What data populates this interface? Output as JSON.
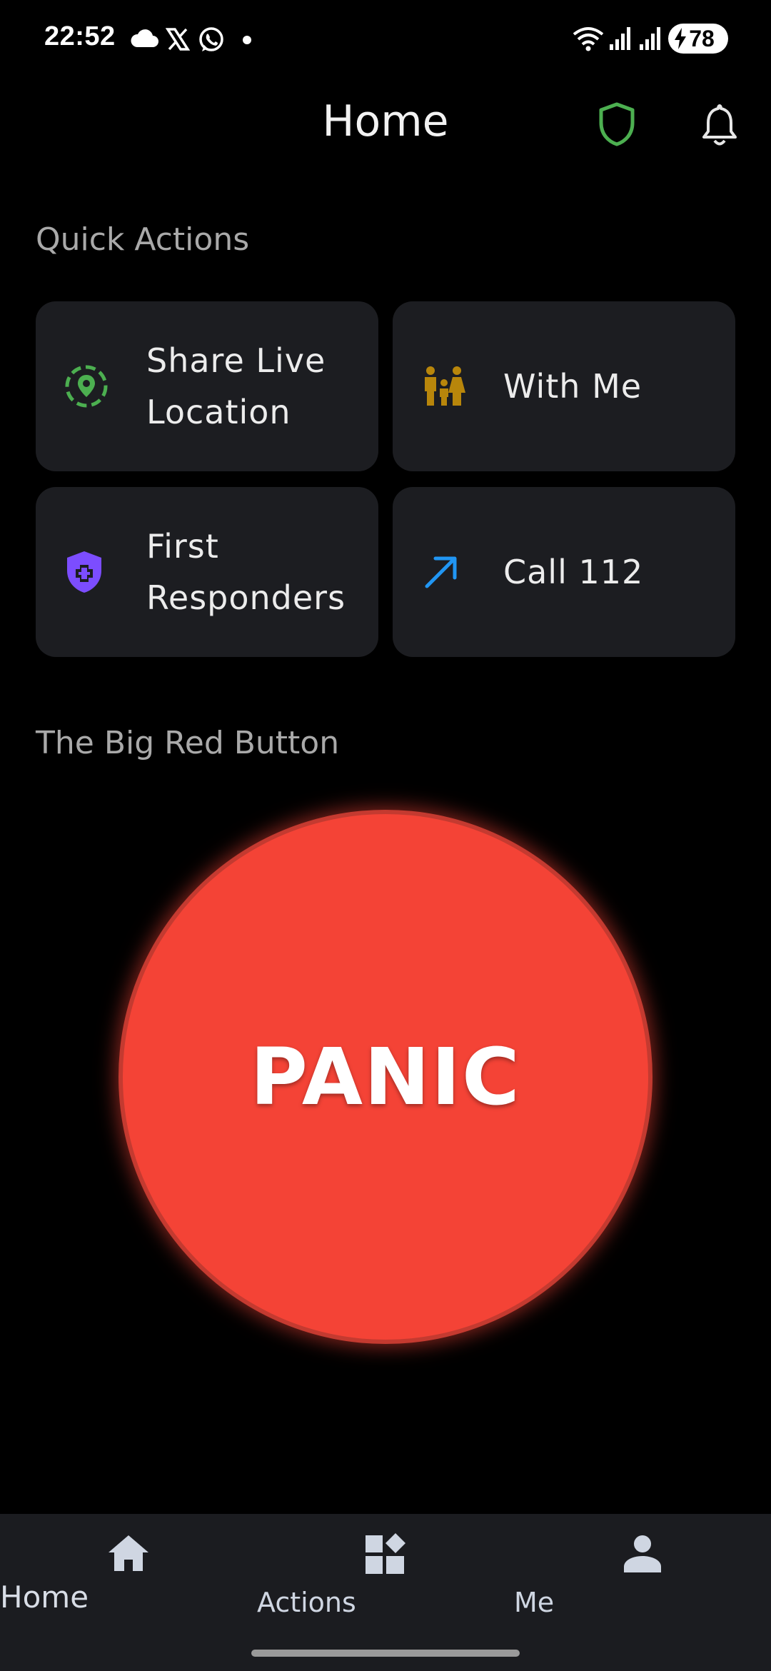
{
  "status_bar": {
    "time": "22:52",
    "battery": "78",
    "icons": [
      "cloud-icon",
      "x-logo-icon",
      "whatsapp-icon",
      "wifi-icon",
      "signal-icon",
      "signal-icon",
      "battery-icon"
    ]
  },
  "header": {
    "title": "Home",
    "icons": [
      "shield-icon",
      "bell-icon"
    ],
    "shield_color": "#4caf50"
  },
  "quick_actions": {
    "title": "Quick Actions",
    "items": [
      {
        "label": "Share Live Location",
        "icon": "location-pin-icon",
        "color": "#4caf50"
      },
      {
        "label": "With Me",
        "icon": "family-icon",
        "color": "#b8860b"
      },
      {
        "label": "First Responders",
        "icon": "medical-shield-icon",
        "color": "#7c4dff"
      },
      {
        "label": "Call 112",
        "icon": "arrow-up-right-icon",
        "color": "#2196f3"
      }
    ]
  },
  "panic_section": {
    "title": "The Big Red Button",
    "button_label": "PANIC",
    "button_color": "#f44336"
  },
  "bottom_nav": {
    "items": [
      {
        "label": "Home",
        "icon": "home-icon",
        "active": true
      },
      {
        "label": "Actions",
        "icon": "dashboard-icon",
        "active": false
      },
      {
        "label": "Me",
        "icon": "person-icon",
        "active": false
      }
    ]
  }
}
